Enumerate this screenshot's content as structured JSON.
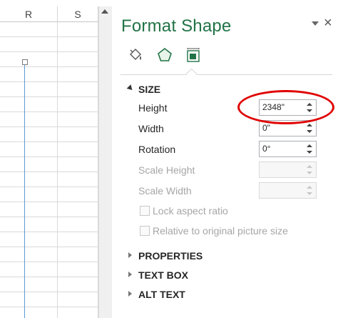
{
  "sheet": {
    "columns": [
      "R",
      "S"
    ]
  },
  "pane": {
    "title": "Format Shape",
    "close_glyph": "×",
    "tabs": [
      {
        "name": "fill-line",
        "icon": "paint-bucket-icon"
      },
      {
        "name": "effects",
        "icon": "pentagon-icon"
      },
      {
        "name": "size-properties",
        "icon": "size-properties-icon"
      }
    ],
    "size_section": {
      "label": "SIZE",
      "height_label": "Height",
      "height_value": "2348\"",
      "width_label": "Width",
      "width_value": "0\"",
      "rotation_label": "Rotation",
      "rotation_value": "0°",
      "scale_height_label": "Scale Height",
      "scale_width_label": "Scale Width",
      "lock_aspect_label": "Lock aspect ratio",
      "relative_label": "Relative to original picture size"
    },
    "sections": [
      {
        "label": "PROPERTIES"
      },
      {
        "label": "TEXT BOX"
      },
      {
        "label": "ALT TEXT"
      }
    ]
  },
  "colors": {
    "accent": "#217346",
    "highlight": "#e00000",
    "shape_line": "#5b9bd5"
  }
}
